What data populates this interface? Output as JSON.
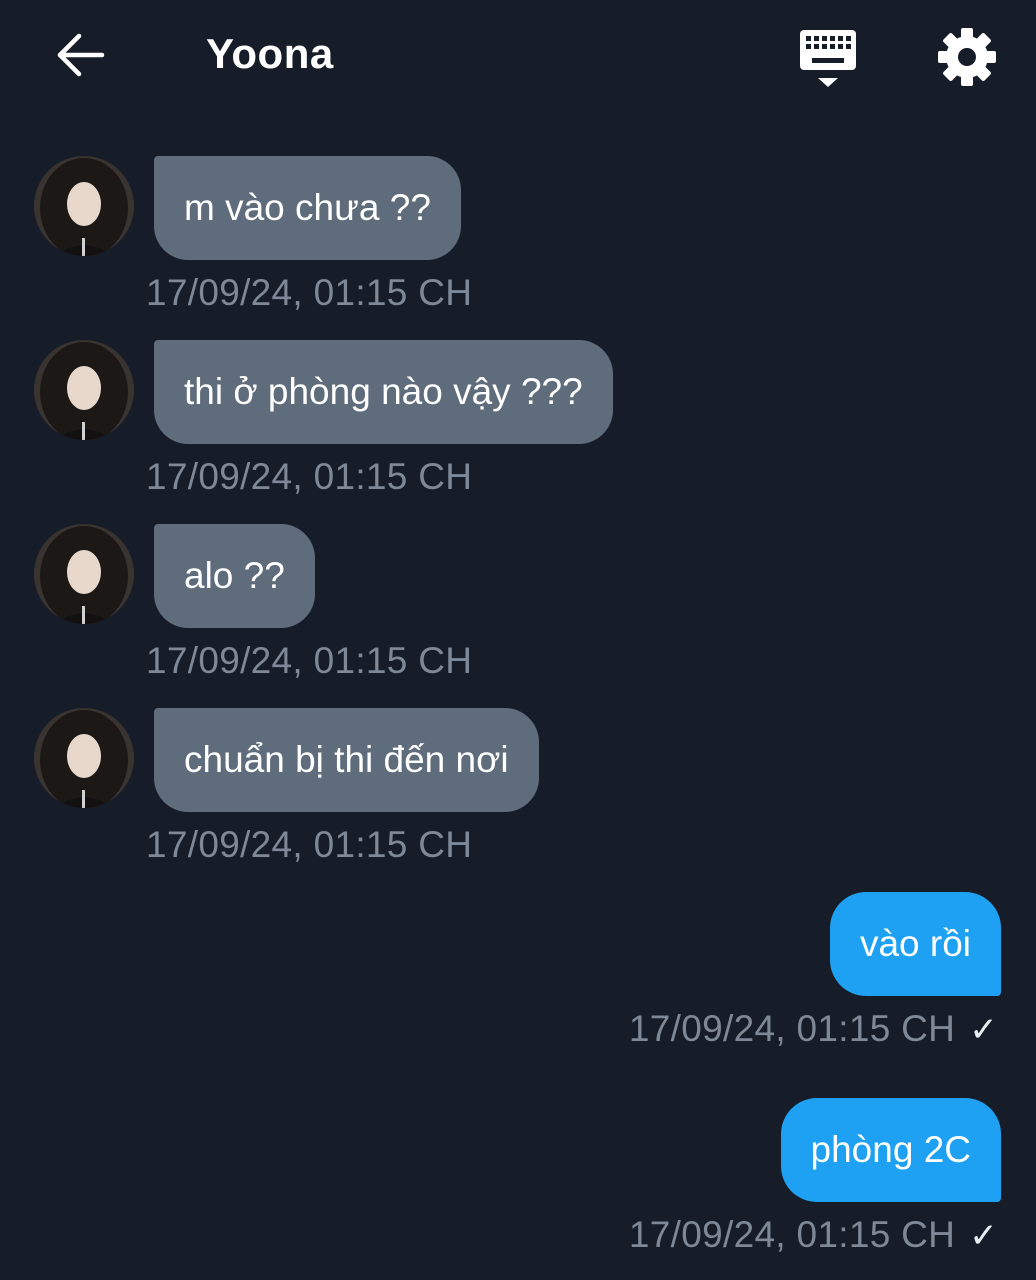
{
  "header": {
    "title": "Yoona",
    "back_icon": "arrow-left-icon",
    "keyboard_icon": "keyboard-icon",
    "settings_icon": "gear-icon"
  },
  "messages": [
    {
      "direction": "incoming",
      "text": "m vào chưa ??",
      "time": "17/09/24, 01:15 CH"
    },
    {
      "direction": "incoming",
      "text": "thi ở phòng nào vậy ???",
      "time": "17/09/24, 01:15 CH"
    },
    {
      "direction": "incoming",
      "text": "alo ??",
      "time": "17/09/24, 01:15 CH"
    },
    {
      "direction": "incoming",
      "text": "chuẩn bị thi đến nơi",
      "time": "17/09/24, 01:15 CH"
    },
    {
      "direction": "outgoing",
      "text": "vào rồi",
      "time": "17/09/24, 01:15 CH",
      "status": "✓"
    },
    {
      "direction": "outgoing",
      "text": "phòng 2C",
      "time": "17/09/24, 01:15 CH",
      "status": "✓"
    }
  ],
  "colors": {
    "background": "#161d28",
    "incoming_bubble": "#5f6c7c",
    "outgoing_bubble": "#1ea1f2",
    "timestamp": "#7e8896"
  }
}
